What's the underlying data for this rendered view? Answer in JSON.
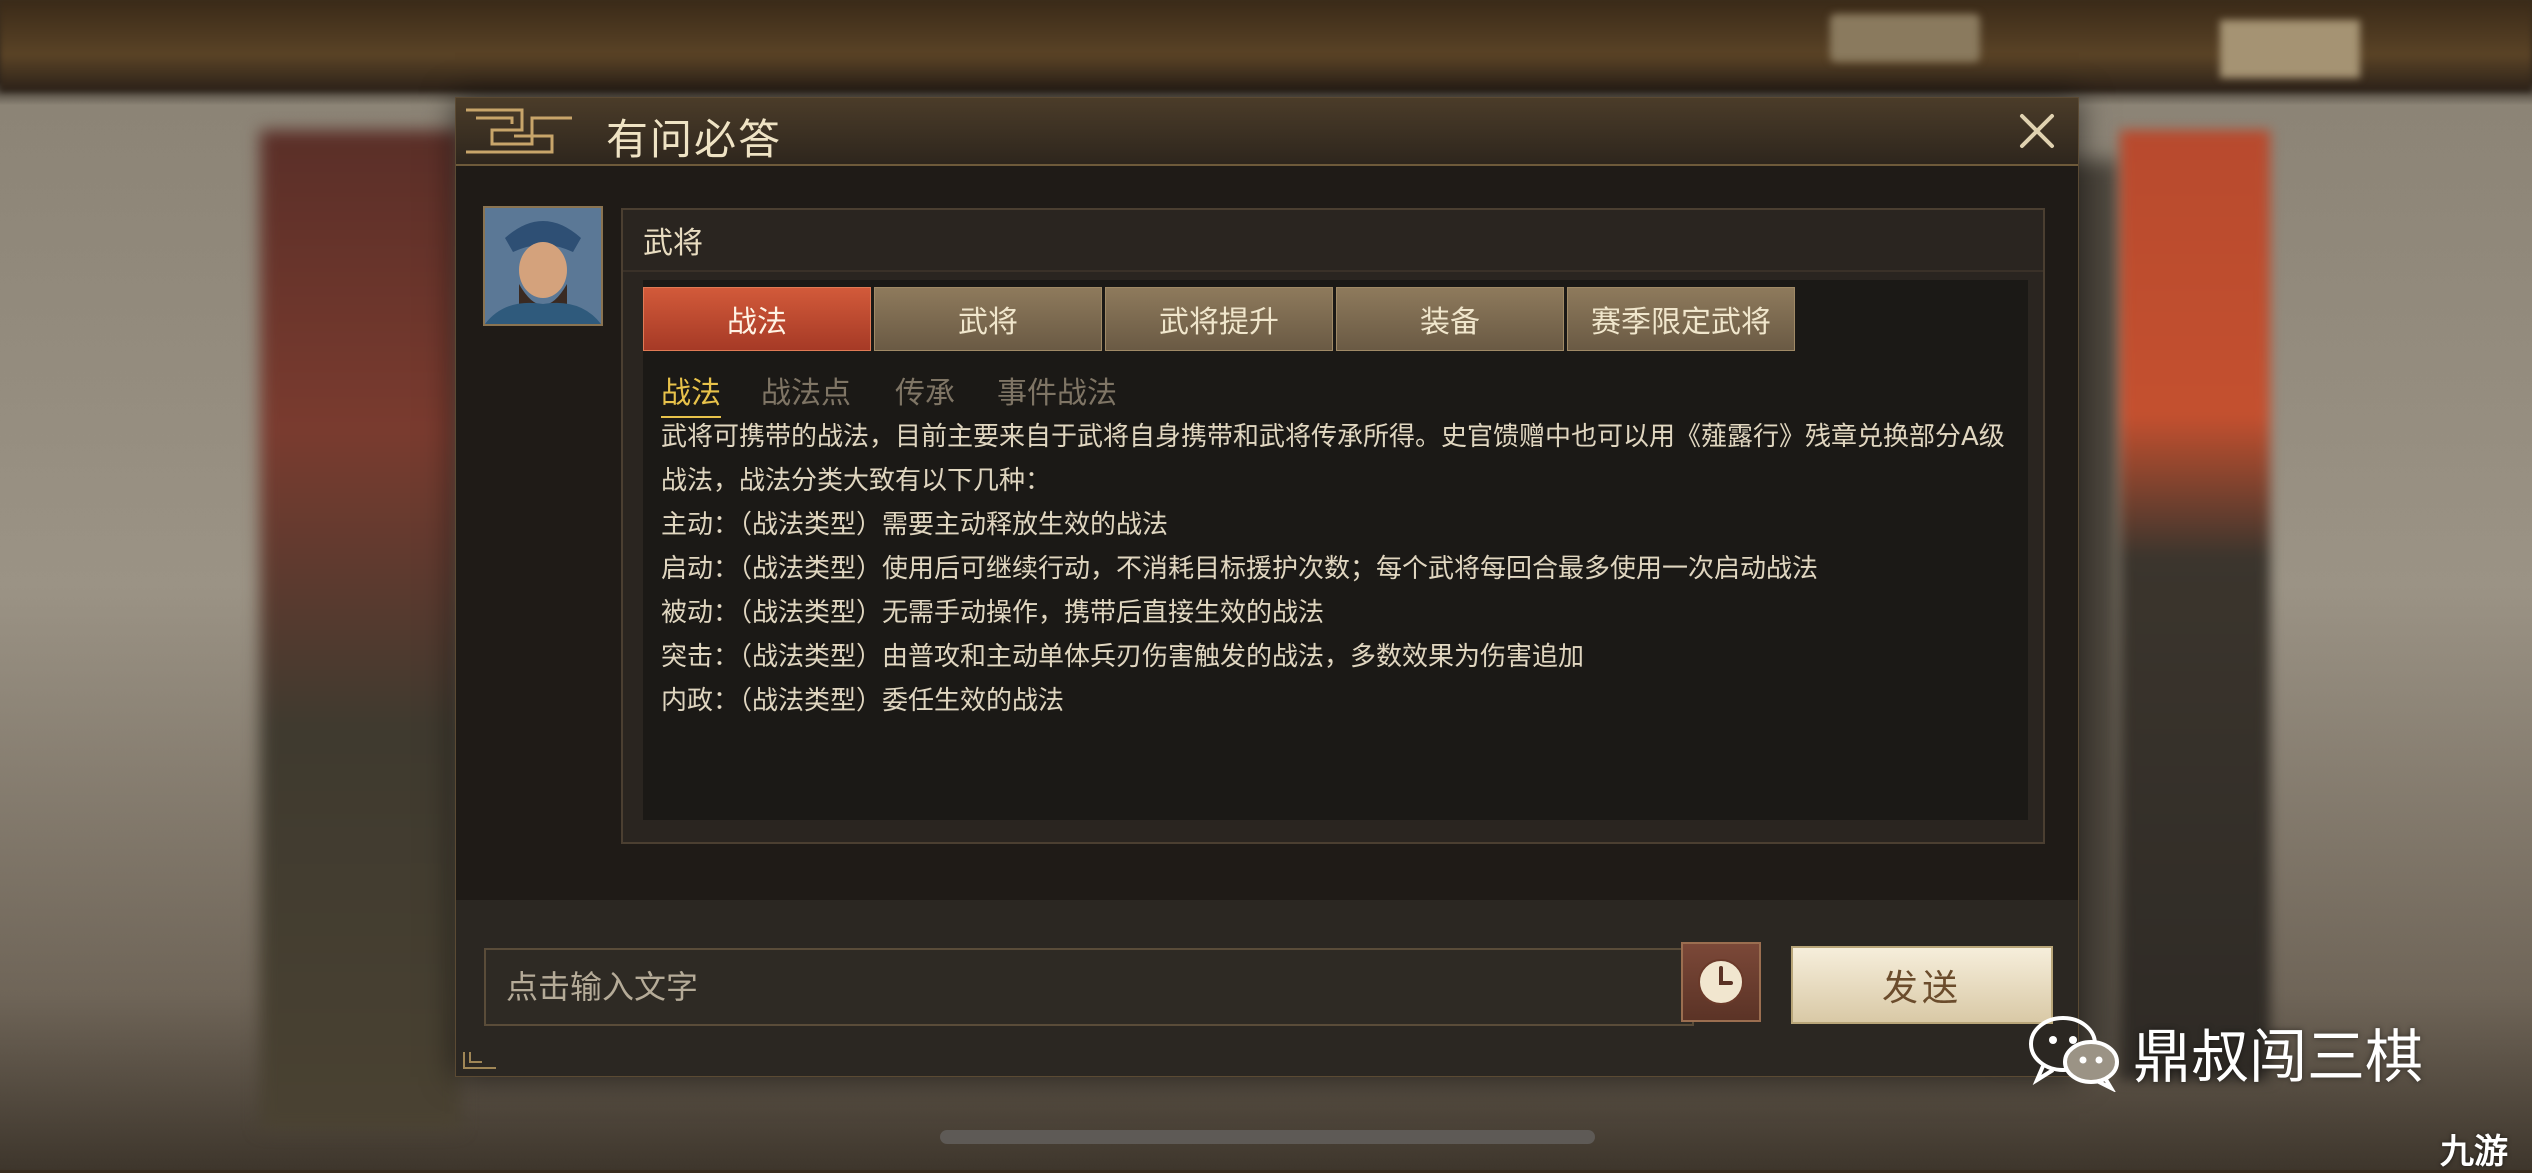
{
  "dialog": {
    "title": "有问必答",
    "section_title": "武将",
    "tabs": [
      {
        "label": "战法",
        "active": true
      },
      {
        "label": "武将",
        "active": false
      },
      {
        "label": "武将提升",
        "active": false
      },
      {
        "label": "装备",
        "active": false
      },
      {
        "label": "赛季限定武将",
        "active": false
      }
    ],
    "subtabs": [
      {
        "label": "战法",
        "active": true
      },
      {
        "label": "战法点",
        "active": false
      },
      {
        "label": "传承",
        "active": false
      },
      {
        "label": "事件战法",
        "active": false
      }
    ],
    "content_lines": [
      "武将可携带的战法，目前主要来自于武将自身携带和武将传承所得。史官馈赠中也可以用《薤露行》残章兑换部分A级战法，战法分类大致有以下几种：",
      "主动：（战法类型）需要主动释放生效的战法",
      "启动：（战法类型）使用后可继续行动，不消耗目标援护次数；每个武将每回合最多使用一次启动战法",
      "被动：（战法类型）无需手动操作，携带后直接生效的战法",
      "突击：（战法类型）由普攻和主动单体兵刃伤害触发的战法，多数效果为伤害追加",
      "内政：（战法类型）委任生效的战法"
    ],
    "input": {
      "placeholder": "点击输入文字",
      "value": ""
    },
    "history_icon": "clock-icon",
    "send_label": "发送",
    "close_icon": "close-icon"
  },
  "watermark": {
    "text": "鼎叔闯三棋",
    "icon": "wechat-icon",
    "site": "九游"
  },
  "colors": {
    "accent_active_tab": "#c44a2f",
    "subtab_active": "#e8c24a",
    "send_button_text": "#6b4c2c"
  }
}
